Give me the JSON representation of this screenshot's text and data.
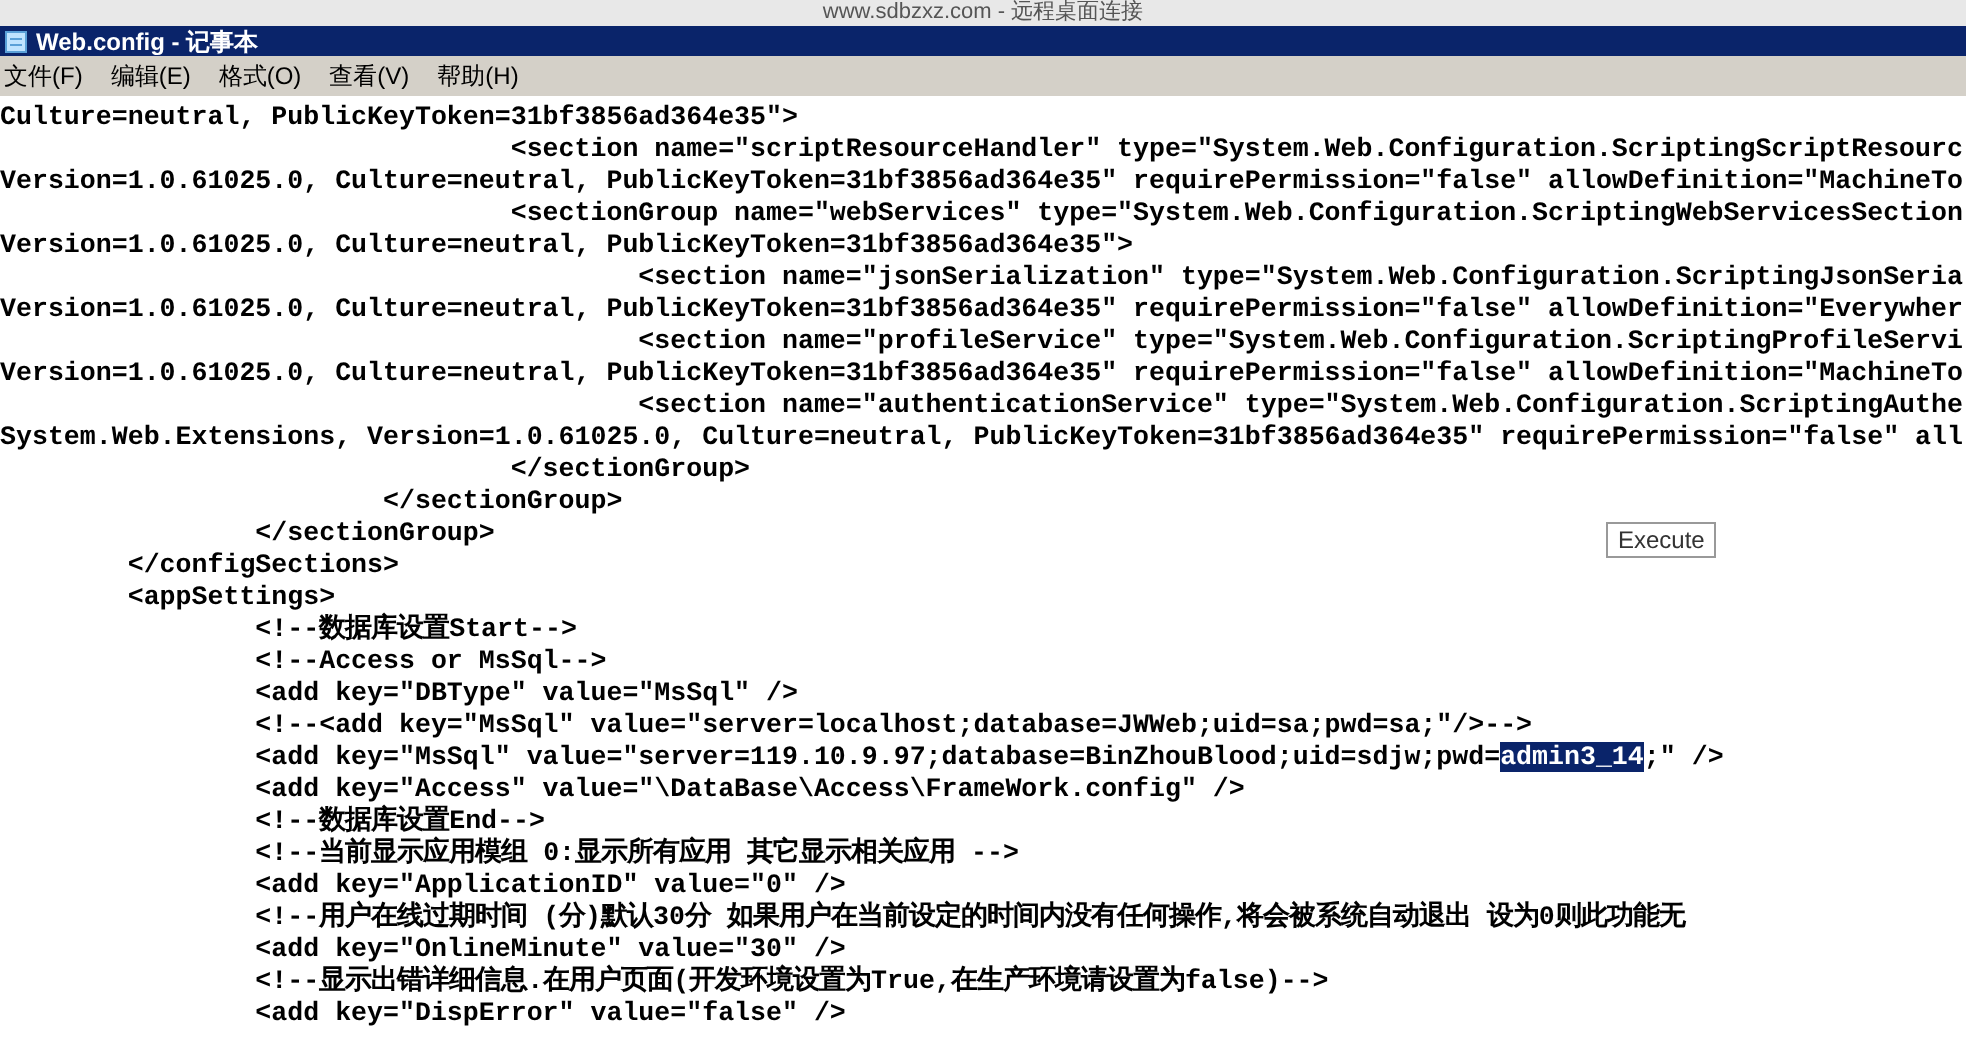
{
  "remote_title": "www.sdbzxz.com - 远程桌面连接",
  "window": {
    "title": "Web.config - 记事本"
  },
  "menu": [
    "文件(F)",
    "编辑(E)",
    "格式(O)",
    "查看(V)",
    "帮助(H)"
  ],
  "lines": [
    {
      "text": "Culture=neutral, PublicKeyToken=31bf3856ad364e35\">"
    },
    {
      "text": "                                <section name=\"scriptResourceHandler\" type=\"System.Web.Configuration.ScriptingScriptResourc"
    },
    {
      "text": "Version=1.0.61025.0, Culture=neutral, PublicKeyToken=31bf3856ad364e35\" requirePermission=\"false\" allowDefinition=\"MachineTo"
    },
    {
      "text": "                                <sectionGroup name=\"webServices\" type=\"System.Web.Configuration.ScriptingWebServicesSection"
    },
    {
      "text": "Version=1.0.61025.0, Culture=neutral, PublicKeyToken=31bf3856ad364e35\">"
    },
    {
      "text": "                                        <section name=\"jsonSerialization\" type=\"System.Web.Configuration.ScriptingJsonSeria"
    },
    {
      "text": "Version=1.0.61025.0, Culture=neutral, PublicKeyToken=31bf3856ad364e35\" requirePermission=\"false\" allowDefinition=\"Everywher"
    },
    {
      "text": "                                        <section name=\"profileService\" type=\"System.Web.Configuration.ScriptingProfileServi"
    },
    {
      "text": "Version=1.0.61025.0, Culture=neutral, PublicKeyToken=31bf3856ad364e35\" requirePermission=\"false\" allowDefinition=\"MachineTo"
    },
    {
      "text": "                                        <section name=\"authenticationService\" type=\"System.Web.Configuration.ScriptingAuthe"
    },
    {
      "text": "System.Web.Extensions, Version=1.0.61025.0, Culture=neutral, PublicKeyToken=31bf3856ad364e35\" requirePermission=\"false\" all"
    },
    {
      "text": "                                </sectionGroup>"
    },
    {
      "text": "                        </sectionGroup>"
    },
    {
      "text": "                </sectionGroup>"
    },
    {
      "text": "        </configSections>"
    },
    {
      "text": "        <appSettings>"
    },
    {
      "text": "                <!--数据库设置Start-->"
    },
    {
      "text": "                <!--Access or MsSql-->"
    },
    {
      "text": "                <add key=\"DBType\" value=\"MsSql\" />"
    },
    {
      "text": "                <!--<add key=\"MsSql\" value=\"server=localhost;database=JWWeb;uid=sa;pwd=sa;\"/>-->"
    },
    {
      "parts": [
        {
          "text": "                <add key=\"MsSql\" value=\"server=119.10.9.97;database=BinZhouBlood;uid=sdjw;pwd=",
          "selected": false
        },
        {
          "text": "admin3_14",
          "selected": true
        },
        {
          "text": ";\" />",
          "selected": false
        }
      ]
    },
    {
      "text": "                <add key=\"Access\" value=\"\\DataBase\\Access\\FrameWork.config\" />"
    },
    {
      "text": "                <!--数据库设置End-->"
    },
    {
      "text": "                <!--当前显示应用模组 0:显示所有应用 其它显示相关应用 -->"
    },
    {
      "text": "                <add key=\"ApplicationID\" value=\"0\" />"
    },
    {
      "text": "                <!--用户在线过期时间 (分)默认30分 如果用户在当前设定的时间内没有任何操作,将会被系统自动退出 设为0则此功能无"
    },
    {
      "text": "                <add key=\"OnlineMinute\" value=\"30\" />"
    },
    {
      "text": "                <!--显示出错详细信息.在用户页面(开发环境设置为True,在生产环境请设置为false)-->"
    },
    {
      "text": "                <add key=\"DispError\" value=\"false\" />"
    }
  ],
  "tooltip": "Execute"
}
